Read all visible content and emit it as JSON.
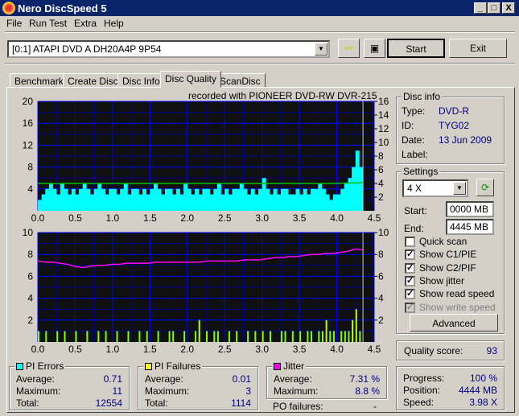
{
  "window": {
    "title": "Nero DiscSpeed 5",
    "min": "_",
    "max": "□",
    "close": "X"
  },
  "menu": [
    "File",
    "Run Test",
    "Extra",
    "Help"
  ],
  "toolbar": {
    "drive": "[0:1]  ATAPI DVD A  DH20A4P 9P54",
    "start": "Start",
    "exit": "Exit"
  },
  "tabs": [
    "Benchmark",
    "Create Disc",
    "Disc Info",
    "Disc Quality",
    "ScanDisc"
  ],
  "active_tab": "Disc Quality",
  "recorded_with": "recorded with PIONEER  DVD-RW  DVR-215",
  "disc_info": {
    "title": "Disc info",
    "type_label": "Type:",
    "type": "DVD-R",
    "id_label": "ID:",
    "id": "TYG02",
    "date_label": "Date:",
    "date": "13 Jun 2009",
    "label_label": "Label:"
  },
  "settings": {
    "title": "Settings",
    "speed": "4 X",
    "start_label": "Start:",
    "start": "0000 MB",
    "end_label": "End:",
    "end": "4445 MB",
    "checks": [
      {
        "label": "Quick scan",
        "checked": false,
        "disabled": false
      },
      {
        "label": "Show C1/PIE",
        "checked": true,
        "disabled": false
      },
      {
        "label": "Show C2/PIF",
        "checked": true,
        "disabled": false
      },
      {
        "label": "Show jitter",
        "checked": true,
        "disabled": false
      },
      {
        "label": "Show read speed",
        "checked": true,
        "disabled": false
      },
      {
        "label": "Show write speed",
        "checked": true,
        "disabled": true
      }
    ],
    "advanced": "Advanced"
  },
  "quality": {
    "label": "Quality score:",
    "value": "93"
  },
  "pi_errors": {
    "title": "PI Errors",
    "color": "#00ffff",
    "avg_label": "Average:",
    "avg": "0.71",
    "max_label": "Maximum:",
    "max": "11",
    "total_label": "Total:",
    "total": "12554"
  },
  "pi_failures": {
    "title": "PI Failures",
    "color": "#ffff00",
    "avg_label": "Average:",
    "avg": "0.01",
    "max_label": "Maximum:",
    "max": "3",
    "total_label": "Total:",
    "total": "1114"
  },
  "jitter": {
    "title": "Jitter",
    "color": "#ff00ff",
    "avg_label": "Average:",
    "avg": "7.31 %",
    "max_label": "Maximum:",
    "max": "8.8 %"
  },
  "po_failures": {
    "label": "PO failures:",
    "value": "-"
  },
  "progress": {
    "progress_label": "Progress:",
    "progress": "100 %",
    "position_label": "Position:",
    "position": "4444 MB",
    "speed_label": "Speed:",
    "speed": "3.98 X"
  },
  "chart_data": [
    {
      "type": "bar",
      "name": "PI errors / read speed",
      "x_ticks": [
        "0.0",
        "0.5",
        "1.0",
        "1.5",
        "2.0",
        "2.5",
        "3.0",
        "3.5",
        "4.0",
        "4.5"
      ],
      "xlim": [
        0,
        4.5
      ],
      "y_left_ticks": [
        "4",
        "8",
        "12",
        "16",
        "20"
      ],
      "ylim_left": [
        0,
        20
      ],
      "y_right_ticks": [
        "2",
        "4",
        "6",
        "8",
        "10",
        "12",
        "14",
        "16"
      ],
      "ylim_right": [
        0,
        16
      ],
      "x_step": 0.05,
      "pie": [
        2,
        3,
        4,
        5,
        4,
        3,
        5,
        4,
        3,
        4,
        3,
        4,
        5,
        4,
        3,
        4,
        5,
        4,
        3,
        4,
        4,
        3,
        4,
        5,
        3,
        4,
        4,
        3,
        4,
        3,
        4,
        5,
        4,
        3,
        4,
        4,
        3,
        4,
        3,
        5,
        4,
        3,
        4,
        3,
        4,
        4,
        3,
        4,
        5,
        3,
        4,
        3,
        4,
        4,
        5,
        4,
        3,
        4,
        3,
        4,
        6,
        4,
        3,
        4,
        3,
        4,
        4,
        3,
        3,
        4,
        3,
        4,
        3,
        4,
        4,
        5,
        4,
        3,
        2,
        3,
        3,
        4,
        5,
        6,
        8,
        11,
        8
      ],
      "read_speed": [
        4,
        4,
        4,
        4,
        4,
        4,
        4,
        4,
        4,
        4.1
      ]
    },
    {
      "type": "bar",
      "name": "PI failures / jitter",
      "x_ticks": [
        "0.0",
        "0.5",
        "1.0",
        "1.5",
        "2.0",
        "2.5",
        "3.0",
        "3.5",
        "4.0",
        "4.5"
      ],
      "xlim": [
        0,
        4.5
      ],
      "y_left_ticks": [
        "2",
        "4",
        "6",
        "8",
        "10"
      ],
      "ylim_left": [
        0,
        10
      ],
      "y_right_ticks": [
        "2",
        "4",
        "6",
        "8",
        "10"
      ],
      "ylim_right": [
        0,
        10
      ],
      "x_step": 0.05,
      "pif": [
        1,
        0,
        1,
        0,
        0,
        1,
        0,
        1,
        0,
        0,
        1,
        0,
        0,
        1,
        0,
        0,
        1,
        0,
        1,
        0,
        0,
        1,
        0,
        0,
        1,
        0,
        0,
        1,
        0,
        1,
        0,
        0,
        1,
        0,
        0,
        1,
        1,
        0,
        0,
        1,
        0,
        0,
        1,
        2,
        0,
        1,
        0,
        1,
        1,
        0,
        0,
        1,
        0,
        1,
        0,
        0,
        1,
        0,
        1,
        0,
        1,
        0,
        1,
        0,
        0,
        1,
        1,
        0,
        1,
        0,
        1,
        0,
        1,
        1,
        0,
        1,
        1,
        2,
        1,
        1,
        0,
        1,
        1,
        1,
        2,
        3,
        1
      ],
      "jitter": [
        7.4,
        7.3,
        7.3,
        7.2,
        7.1,
        6.9,
        6.8,
        6.9,
        7.0,
        7.0,
        7.1,
        7.1,
        7.2,
        7.2,
        7.2,
        7.2,
        7.3,
        7.3,
        7.3,
        7.3,
        7.3,
        7.3,
        7.3,
        7.4,
        7.4,
        7.4,
        7.4,
        7.4,
        7.5,
        7.5,
        7.5,
        7.6,
        7.7,
        7.7,
        7.8,
        7.8,
        7.9,
        8.0,
        8.0,
        8.1,
        8.1,
        8.2,
        8.3,
        8.5,
        8.4
      ]
    }
  ]
}
